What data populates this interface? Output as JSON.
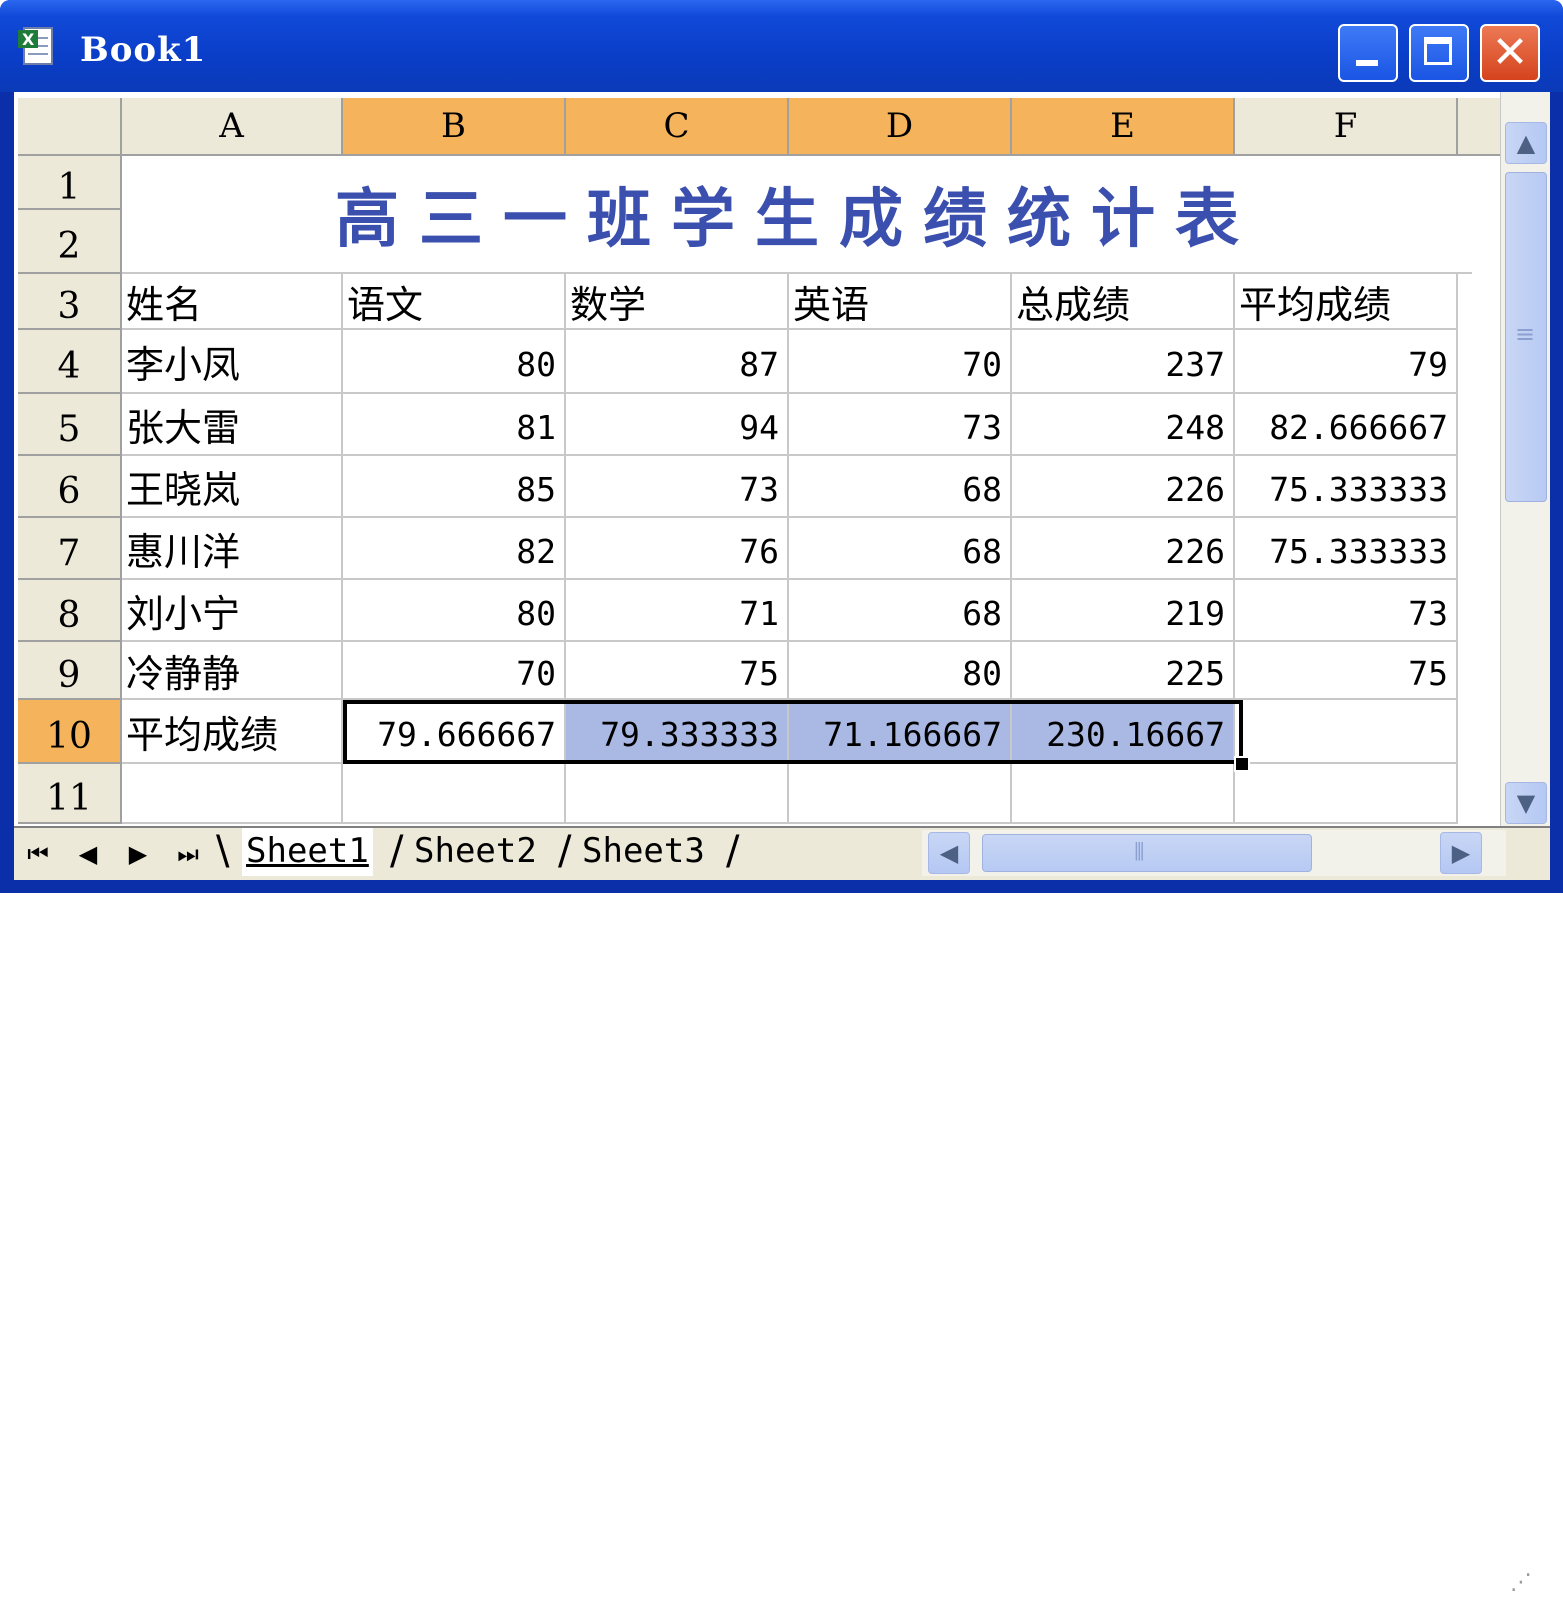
{
  "window": {
    "title": "Book1",
    "close_glyph": "✕"
  },
  "columns": [
    "A",
    "B",
    "C",
    "D",
    "E",
    "F"
  ],
  "rows": [
    "1",
    "2",
    "3",
    "4",
    "5",
    "6",
    "7",
    "8",
    "9",
    "10",
    "11"
  ],
  "selected_columns": [
    "B",
    "C",
    "D",
    "E"
  ],
  "selected_row": "10",
  "title_merged": "高三一班学生成绩统计表",
  "headers": [
    "姓名",
    "语文",
    "数学",
    "英语",
    "总成绩",
    "平均成绩"
  ],
  "table": [
    [
      "李小凤",
      "80",
      "87",
      "70",
      "237",
      "79"
    ],
    [
      "张大雷",
      "81",
      "94",
      "73",
      "248",
      "82.666667"
    ],
    [
      "王晓岚",
      "85",
      "73",
      "68",
      "226",
      "75.333333"
    ],
    [
      "惠川洋",
      "82",
      "76",
      "68",
      "226",
      "75.333333"
    ],
    [
      "刘小宁",
      "80",
      "71",
      "68",
      "219",
      "73"
    ],
    [
      "冷静静",
      "70",
      "75",
      "80",
      "225",
      "75"
    ]
  ],
  "avg_row": [
    "平均成绩",
    "79.666667",
    "79.333333",
    "71.166667",
    "230.16667",
    ""
  ],
  "sheet_nav": [
    "⏮",
    "◀",
    "▶",
    "⏭"
  ],
  "sheet_tabs": [
    "Sheet1",
    "Sheet2",
    "Sheet3"
  ],
  "active_sheet": "Sheet1",
  "colors": {
    "title_text": "#3a4fae",
    "selected_header": "#f5b45c",
    "range_highlight": "#aab9e4",
    "titlebar": "#0a3ec8"
  },
  "icons": {
    "app": "excel-icon",
    "minimize": "minimize-icon",
    "maximize": "maximize-icon",
    "close": "close-icon"
  }
}
